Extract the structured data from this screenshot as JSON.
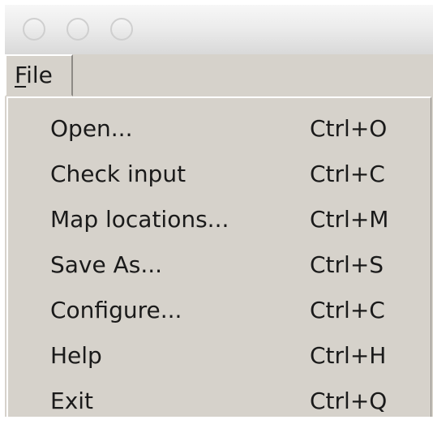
{
  "window": {
    "title_buttons": [
      "close-icon",
      "minimize-icon",
      "maximize-icon"
    ]
  },
  "menubar": {
    "file_label_mnemonic": "F",
    "file_label_rest": "ile"
  },
  "menu": {
    "items": [
      {
        "label": "Open...",
        "shortcut": "Ctrl+O"
      },
      {
        "label": "Check input",
        "shortcut": "Ctrl+C"
      },
      {
        "label": "Map locations...",
        "shortcut": "Ctrl+M"
      },
      {
        "label": "Save As...",
        "shortcut": "Ctrl+S"
      },
      {
        "label": "Configure...",
        "shortcut": "Ctrl+C"
      },
      {
        "label": "Help",
        "shortcut": "Ctrl+H"
      },
      {
        "label": "Exit",
        "shortcut": "Ctrl+Q"
      }
    ]
  },
  "colors": {
    "menu_background": "#d6d2cb",
    "text": "#1a1a1a"
  }
}
